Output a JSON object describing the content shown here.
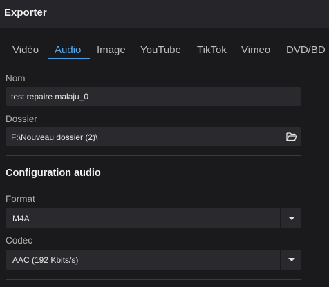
{
  "window": {
    "title": "Exporter"
  },
  "tabs": [
    {
      "label": "Vidéo"
    },
    {
      "label": "Audio",
      "active": true
    },
    {
      "label": "Image"
    },
    {
      "label": "YouTube"
    },
    {
      "label": "TikTok"
    },
    {
      "label": "Vimeo"
    },
    {
      "label": "DVD/BD"
    }
  ],
  "form": {
    "name_label": "Nom",
    "name_value": "test repaire malaju_0",
    "folder_label": "Dossier",
    "folder_value": "F:\\Nouveau dossier (2)\\"
  },
  "audio_config": {
    "section_title": "Configuration audio",
    "format_label": "Format",
    "format_value": "M4A",
    "codec_label": "Codec",
    "codec_value": "AAC (192 Kbits/s)"
  },
  "colors": {
    "accent": "#4a9de2",
    "background": "#1a1a1c",
    "field": "#2a2a2e"
  }
}
